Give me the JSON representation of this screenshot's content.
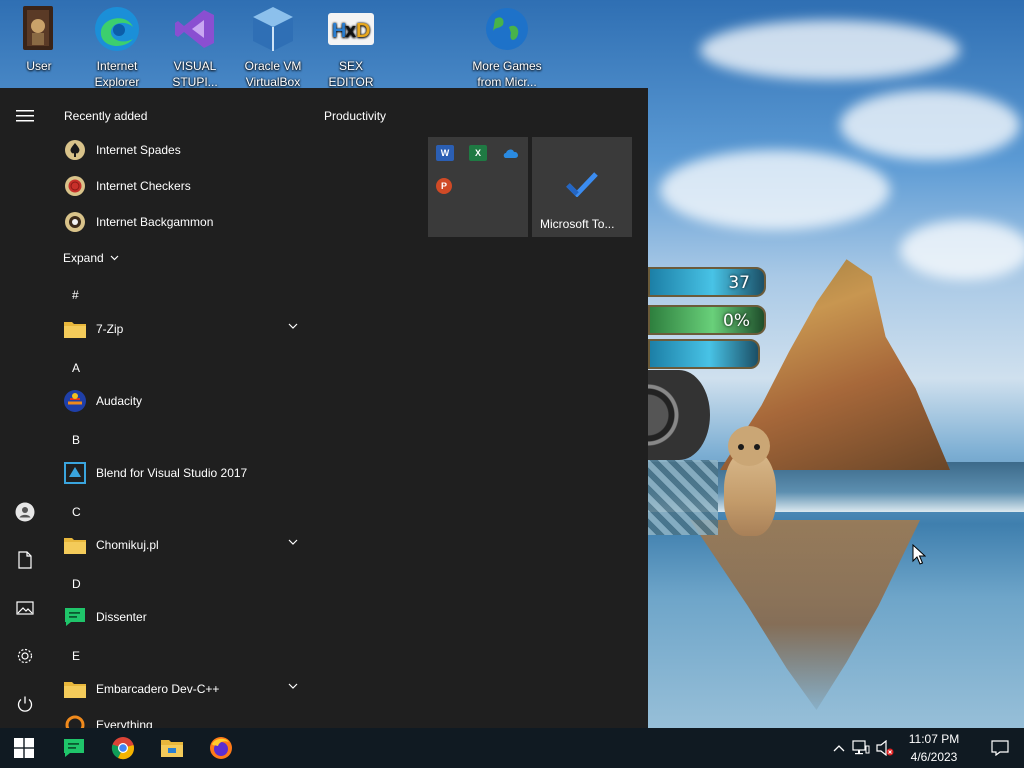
{
  "desktop": {
    "icons": [
      {
        "label": "User",
        "icon": "user-folder-icon"
      },
      {
        "label": "Internet",
        "label2": "Explorer",
        "icon": "edge-icon"
      },
      {
        "label": "VISUAL",
        "label2": "STUPI...",
        "icon": "visual-studio-icon"
      },
      {
        "label": "Oracle VM",
        "label2": "VirtualBox",
        "icon": "virtualbox-icon"
      },
      {
        "label": "SEX",
        "label2": "EDITOR",
        "icon": "hxd-icon"
      },
      {
        "label": "More Games",
        "label2": "from Micr...",
        "icon": "globe-icon"
      }
    ],
    "gadget": {
      "value1": "37",
      "value2": "0%"
    }
  },
  "start_menu": {
    "recently_added_title": "Recently added",
    "recent": [
      {
        "name": "Internet Spades",
        "icon": "spades-icon"
      },
      {
        "name": "Internet Checkers",
        "icon": "checkers-icon"
      },
      {
        "name": "Internet Backgammon",
        "icon": "backgammon-icon"
      }
    ],
    "expand_label": "Expand",
    "letters": {
      "hash": "#",
      "a": "A",
      "b": "B",
      "c": "C",
      "d": "D",
      "e": "E"
    },
    "apps": [
      {
        "name": "7-Zip",
        "icon": "folder-icon"
      },
      {
        "name": "Audacity",
        "icon": "audacity-icon"
      },
      {
        "name": "Blend for Visual Studio 2017",
        "icon": "blend-icon"
      },
      {
        "name": "Chomikuj.pl",
        "icon": "folder-icon"
      },
      {
        "name": "Dissenter",
        "icon": "dissenter-icon"
      },
      {
        "name": "Embarcadero Dev-C++",
        "icon": "folder-icon"
      },
      {
        "name": "Everything",
        "icon": "everything-icon"
      }
    ],
    "tiles": {
      "group_title": "Productivity",
      "todo_label": "Microsoft To...",
      "office_minis": [
        "W",
        "X",
        "P"
      ]
    }
  },
  "taskbar": {
    "time": "11:07 PM",
    "date": "4/6/2023"
  },
  "colors": {
    "menu_bg": "#1f1f1f",
    "tile_bg": "#3a3a3a",
    "taskbar_bg": "#101a22",
    "folder": "#e8b73c",
    "accent_blue": "#2b7cd3"
  }
}
